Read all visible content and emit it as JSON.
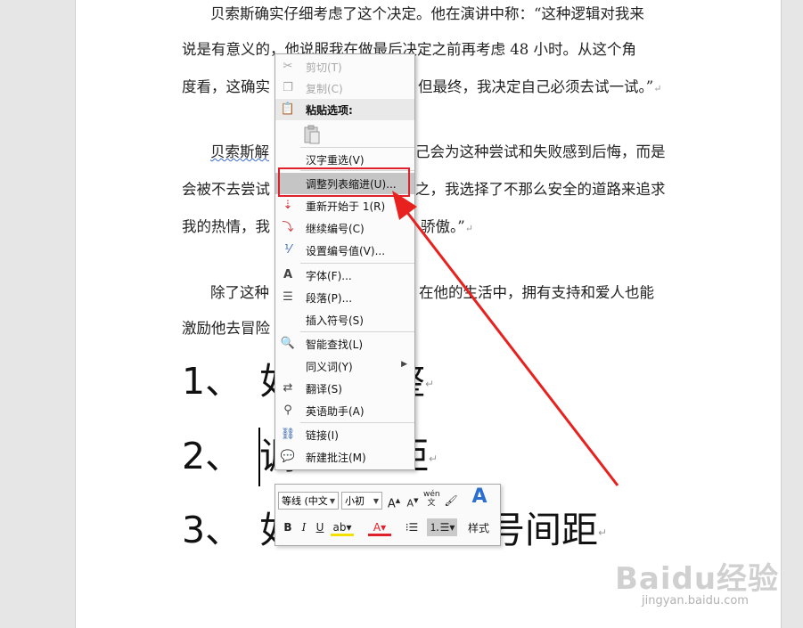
{
  "document": {
    "lines": [
      "贝索斯确实仔细考虑了这个决定。他在演讲中称：“这种逻辑对我来",
      "说是有意义的，他说服我在做最后决定之前再考虑 48 小时。从这个角",
      "度看，这确实",
      "但最终，我决定自己必须去试一试。”",
      "贝索斯解",
      "己会为这种尝试和失败感到后悔，而是",
      "会被不去尝试",
      "之，我选择了不那么安全的道路来追求",
      "我的热情，我",
      "骄傲。”",
      "除了这种",
      "在他的生活中，拥有支持和爱人也能",
      "激励他去冒险"
    ],
    "para_mark": "↵",
    "list_items": [
      {
        "num": "1、",
        "text": "如",
        "tail": "整"
      },
      {
        "num": "2、",
        "text": "调",
        "tail": "距"
      },
      {
        "num": "3、",
        "text": "如",
        "tail": "号间距"
      }
    ]
  },
  "context_menu": {
    "cut": "剪切(T)",
    "copy": "复制(C)",
    "paste_options": "粘贴选项:",
    "reconvert": "汉字重选(V)",
    "adjust_list_indent": "调整列表缩进(U)...",
    "restart_at_1": "重新开始于 1(R)",
    "continue_numbering": "继续编号(C)",
    "set_numbering_value": "设置编号值(V)...",
    "font": "字体(F)...",
    "paragraph": "段落(P)...",
    "insert_symbol": "插入符号(S)",
    "smart_lookup": "智能查找(L)",
    "synonyms": "同义词(Y)",
    "translate": "翻译(S)",
    "english_assistant": "英语助手(A)",
    "link": "链接(I)",
    "new_comment": "新建批注(M)"
  },
  "mini_toolbar": {
    "font_name": "等线 (中文",
    "font_size": "小初",
    "styles": "样式",
    "bold": "B",
    "italic": "I",
    "underline": "U"
  },
  "watermark": {
    "logo": "Baidu经验",
    "url": "jingyan.baidu.com"
  },
  "colors": {
    "highlight_border": "#e0202a",
    "arrow": "#e8201e",
    "menu_hover": "#c5c5c5"
  }
}
